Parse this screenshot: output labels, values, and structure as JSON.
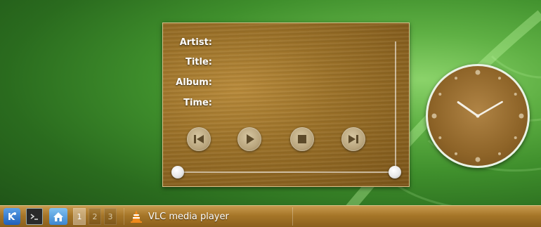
{
  "player": {
    "labels": {
      "artist": "Artist:",
      "title": "Title:",
      "album": "Album:",
      "time": "Time:"
    },
    "values": {
      "artist": "",
      "title": "",
      "album": "",
      "time": ""
    },
    "volume_level": 0.0,
    "position_level": 0.0,
    "controls": [
      "previous-icon",
      "play-icon",
      "stop-icon",
      "next-icon"
    ]
  },
  "clock": {
    "hour": 10,
    "minute": 10
  },
  "taskbar": {
    "desktops": [
      "1",
      "2",
      "3"
    ],
    "active_desktop": "1",
    "task": {
      "label": "VLC media player",
      "icon": "vlc-cone-icon"
    }
  },
  "colors": {
    "wood": "#9b7128",
    "leaf": "#3f8f2c"
  }
}
